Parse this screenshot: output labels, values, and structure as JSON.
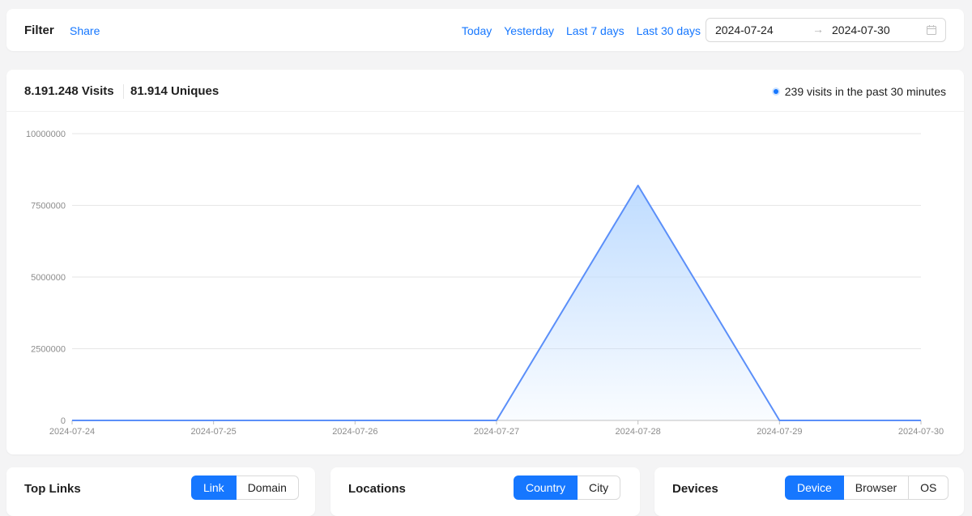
{
  "filter": {
    "title": "Filter",
    "share_label": "Share",
    "quick_ranges": [
      "Today",
      "Yesterday",
      "Last 7 days",
      "Last 30 days"
    ],
    "range_start": "2024-07-24",
    "range_end": "2024-07-30",
    "range_separator": "→"
  },
  "stats": {
    "visits": "8.191.248 Visits",
    "uniques": "81.914 Uniques",
    "live": "239 visits in the past 30 minutes"
  },
  "colors": {
    "accent": "#1677ff",
    "line": "#5b8ff9",
    "area": "#bfdcff"
  },
  "chart_data": {
    "type": "area",
    "x": [
      "2024-07-24",
      "2024-07-25",
      "2024-07-26",
      "2024-07-27",
      "2024-07-28",
      "2024-07-29",
      "2024-07-30"
    ],
    "series": [
      {
        "values": [
          0,
          0,
          0,
          0,
          8191248,
          0,
          0
        ]
      }
    ],
    "ylim": [
      0,
      10000000
    ],
    "yticks": [
      0,
      2500000,
      5000000,
      7500000,
      10000000
    ],
    "ytick_labels": [
      "0",
      "2500000",
      "5000000",
      "7500000",
      "10000000"
    ],
    "grid": true
  },
  "panels": {
    "top_links": {
      "title": "Top Links",
      "tabs": [
        "Link",
        "Domain"
      ],
      "active": 0
    },
    "locations": {
      "title": "Locations",
      "tabs": [
        "Country",
        "City"
      ],
      "active": 0
    },
    "devices": {
      "title": "Devices",
      "tabs": [
        "Device",
        "Browser",
        "OS"
      ],
      "active": 0
    }
  }
}
